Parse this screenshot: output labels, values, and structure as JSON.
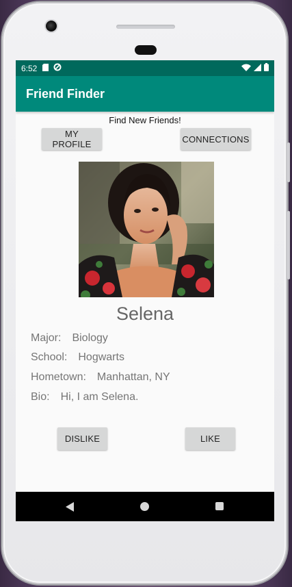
{
  "status_bar": {
    "time": "6:52",
    "icons_left": [
      "sd-card-icon",
      "data-saver-icon"
    ],
    "icons_right": [
      "wifi-icon",
      "cell-signal-icon",
      "battery-icon"
    ]
  },
  "app_bar": {
    "title": "Friend Finder"
  },
  "main": {
    "subtitle": "Find New Friends!",
    "my_profile_label": "MY PROFILE",
    "connections_label": "CONNECTIONS",
    "profile": {
      "name": "Selena",
      "major_label": "Major:",
      "major": "Biology",
      "school_label": "School:",
      "school": "Hogwarts",
      "hometown_label": "Hometown:",
      "hometown": "Manhattan, NY",
      "bio_label": "Bio:",
      "bio": "Hi, I am Selena."
    },
    "dislike_label": "DISLIKE",
    "like_label": "LIKE"
  },
  "nav_bar": {
    "icons": [
      "back-icon",
      "home-icon",
      "recents-icon"
    ]
  },
  "colors": {
    "status_bar": "#00695c",
    "app_bar": "#00897b",
    "button": "#d6d7d7",
    "screen_bg": "#fafafa"
  }
}
